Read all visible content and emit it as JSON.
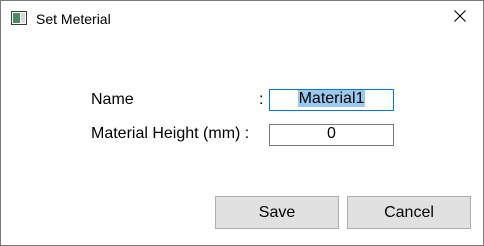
{
  "window": {
    "title": "Set Meterial",
    "icon": "window-app-icon",
    "close_icon": "close-icon"
  },
  "form": {
    "name_label": "Name",
    "name_colon": ":",
    "name_value": "Material1",
    "height_label": "Material Height (mm) :",
    "height_value": "0"
  },
  "buttons": {
    "save_label": "Save",
    "cancel_label": "Cancel"
  },
  "colors": {
    "selection": "#99c9ef",
    "focus_border": "#0078d7",
    "button_bg": "#e1e1e1"
  }
}
